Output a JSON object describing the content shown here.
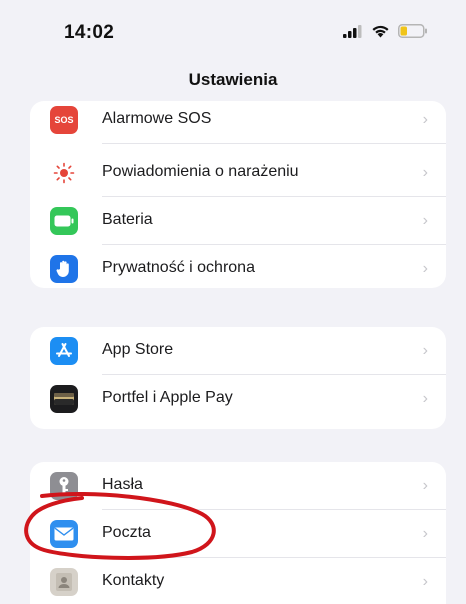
{
  "status_bar": {
    "time": "14:02"
  },
  "header": {
    "title": "Ustawienia"
  },
  "groups": [
    {
      "items": [
        {
          "label": "Alarmowe SOS",
          "icon": "sos-icon",
          "icon_text": "SOS",
          "color": "#e5453a"
        },
        {
          "label": "Powiadomienia o narażeniu",
          "icon": "exposure-icon",
          "color": "#ffffff"
        },
        {
          "label": "Bateria",
          "icon": "battery-icon",
          "color": "#34c759"
        },
        {
          "label": "Prywatność i ochrona",
          "icon": "hand-icon",
          "color": "#1f74e8"
        }
      ]
    },
    {
      "items": [
        {
          "label": "App Store",
          "icon": "app-store-icon",
          "color": "#1c8ef3"
        },
        {
          "label": "Portfel i Apple Pay",
          "icon": "wallet-icon",
          "color": "#1c1c1e"
        }
      ]
    },
    {
      "items": [
        {
          "label": "Hasła",
          "icon": "key-icon",
          "color": "#8e8e93"
        },
        {
          "label": "Poczta",
          "icon": "mail-icon",
          "color": "#2f8fef"
        },
        {
          "label": "Kontakty",
          "icon": "contacts-icon",
          "color": "#c8c3bb"
        }
      ]
    }
  ],
  "chevron": "›",
  "annotation": {
    "color": "#d0151b"
  }
}
